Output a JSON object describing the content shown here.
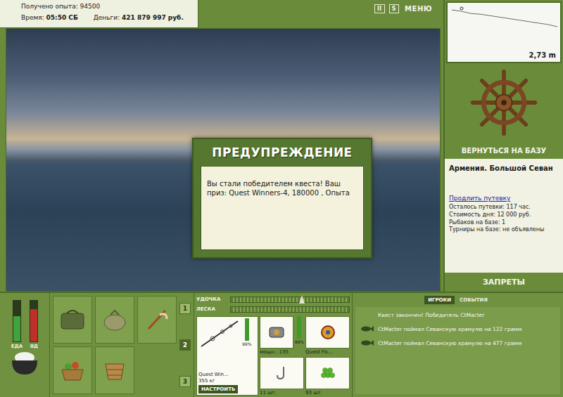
{
  "hud": {
    "experience": "Получено опыта: 94500",
    "time_label": "Время:",
    "time": "05:50 СБ",
    "money_label": "Деньги:",
    "money": "421 879 997 руб."
  },
  "toolbar": [
    {
      "label": "II"
    },
    {
      "label": "S"
    },
    {
      "label": "МЕНЮ"
    }
  ],
  "dialog": {
    "title": "ПРЕДУПРЕЖДЕНИЕ",
    "message": "Вы стали победителем квеста! Ваш приз: Quest Winners-4, 180000 , Опыта"
  },
  "depth_chart": {
    "values": [
      2.5,
      2.52,
      2.55,
      2.56,
      2.58,
      2.6,
      2.62,
      2.64,
      2.66,
      2.68,
      2.7,
      2.73
    ],
    "reading": "2,73 m"
  },
  "base": {
    "button": "ВЕРНУТЬСЯ НА БАЗУ",
    "location": "Армения. Большой Севан",
    "extend_link": "Продлить путевку",
    "lines": [
      "Осталось путевки: 117 час.",
      "Стоимость дня: 12 000 руб.",
      "Рыбаков на базе: 1",
      "Турниры на базе: не объявлены"
    ],
    "restrictions": "ЗАПРЕТЫ"
  },
  "meters": [
    {
      "label": "ЕДА",
      "level": 0.62,
      "color": "#3fa53a"
    },
    {
      "label": "ЯД",
      "level": 0.8,
      "color": "#c0302a"
    }
  ],
  "pages": [
    {
      "label": "1",
      "selected": false
    },
    {
      "label": "2",
      "selected": true
    },
    {
      "label": "3",
      "selected": false
    }
  ],
  "tension": [
    {
      "label": "УДОЧКА",
      "level": 0.6
    },
    {
      "label": "ЛЕСКА",
      "level": 0
    }
  ],
  "tackle": {
    "rod": {
      "name": "Quest Win...",
      "detail": "355 кг",
      "condition": "99%",
      "level": 0.99
    },
    "reel": {
      "detail": "мощн.: 135",
      "condition": "99%",
      "level": 0.99
    },
    "lure": {
      "name": "Quest Fis..."
    },
    "hook": {
      "count": "11 шт."
    },
    "bait": {
      "count": "93 шт."
    },
    "button": "НАСТРОИТЬ"
  },
  "log": {
    "tabs": [
      {
        "label": "ИГРОКИ",
        "selected": true
      },
      {
        "label": "СОБЫТИЯ",
        "selected": false
      }
    ],
    "entries": [
      {
        "text": "Квест закончен! Победитель CtMacter",
        "kind": "notice"
      },
      {
        "text": "CtMacter поймал Севанскую храмулю на 122 грамм",
        "kind": "catch"
      },
      {
        "text": "CtMacter поймал Севанскую храмулю на 477 грамм",
        "kind": "catch"
      }
    ]
  }
}
